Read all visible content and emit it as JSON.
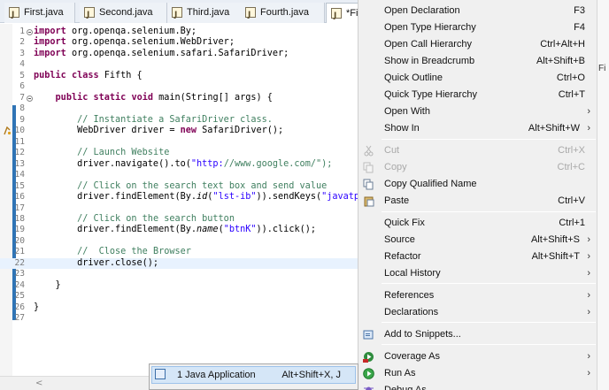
{
  "tabs": [
    {
      "label": "First.java"
    },
    {
      "label": "Second.java"
    },
    {
      "label": "Third.java"
    },
    {
      "label": "Fourth.java"
    },
    {
      "label": "*Fif"
    }
  ],
  "code_lines": [
    {
      "n": "1",
      "text": "import org.openqa.selenium.By;"
    },
    {
      "n": "2",
      "text": "import org.openqa.selenium.WebDriver;"
    },
    {
      "n": "3",
      "text": "import org.openqa.selenium.safari.SafariDriver;"
    },
    {
      "n": "4",
      "text": ""
    },
    {
      "n": "5",
      "text": "public class Fifth {"
    },
    {
      "n": "6",
      "text": ""
    },
    {
      "n": "7",
      "text": "    public static void main(String[] args) {"
    },
    {
      "n": "8",
      "text": ""
    },
    {
      "n": "9",
      "text": "        // Instantiate a SafariDriver class."
    },
    {
      "n": "10",
      "text": "        WebDriver driver = new SafariDriver();"
    },
    {
      "n": "11",
      "text": ""
    },
    {
      "n": "12",
      "text": "        // Launch Website"
    },
    {
      "n": "13",
      "text": "        driver.navigate().to(\"http://www.google.com/\");"
    },
    {
      "n": "14",
      "text": ""
    },
    {
      "n": "15",
      "text": "        // Click on the search text box and send value"
    },
    {
      "n": "16",
      "text": "        driver.findElement(By.id(\"lst-ib\")).sendKeys(\"javatpo"
    },
    {
      "n": "17",
      "text": ""
    },
    {
      "n": "18",
      "text": "        // Click on the search button"
    },
    {
      "n": "19",
      "text": "        driver.findElement(By.name(\"btnK\")).click();"
    },
    {
      "n": "20",
      "text": ""
    },
    {
      "n": "21",
      "text": "        //  Close the Browser"
    },
    {
      "n": "22",
      "text": "        driver.close();"
    },
    {
      "n": "23",
      "text": ""
    },
    {
      "n": "24",
      "text": "    }"
    },
    {
      "n": "25",
      "text": ""
    },
    {
      "n": "26",
      "text": "}"
    },
    {
      "n": "27",
      "text": ""
    }
  ],
  "context_menu": {
    "items": [
      {
        "label": "Open Declaration",
        "shortcut": "F3"
      },
      {
        "label": "Open Type Hierarchy",
        "shortcut": "F4"
      },
      {
        "label": "Open Call Hierarchy",
        "shortcut": "Ctrl+Alt+H"
      },
      {
        "label": "Show in Breadcrumb",
        "shortcut": "Alt+Shift+B"
      },
      {
        "label": "Quick Outline",
        "shortcut": "Ctrl+O"
      },
      {
        "label": "Quick Type Hierarchy",
        "shortcut": "Ctrl+T"
      },
      {
        "label": "Open With",
        "shortcut": "",
        "submenu": true
      },
      {
        "label": "Show In",
        "shortcut": "Alt+Shift+W"
      },
      {
        "label": "Cut",
        "shortcut": "Ctrl+X"
      },
      {
        "label": "Copy",
        "shortcut": "Ctrl+C"
      },
      {
        "label": "Copy Qualified Name",
        "shortcut": ""
      },
      {
        "label": "Paste",
        "shortcut": "Ctrl+V"
      },
      {
        "label": "Quick Fix",
        "shortcut": "Ctrl+1"
      },
      {
        "label": "Source",
        "shortcut": "Alt+Shift+S"
      },
      {
        "label": "Refactor",
        "shortcut": "Alt+Shift+T"
      },
      {
        "label": "Local History",
        "shortcut": ""
      },
      {
        "label": "References",
        "shortcut": ""
      },
      {
        "label": "Declarations",
        "shortcut": ""
      },
      {
        "label": "Add to Snippets...",
        "shortcut": ""
      },
      {
        "label": "Coverage As",
        "shortcut": ""
      },
      {
        "label": "Run As",
        "shortcut": ""
      },
      {
        "label": "Debug As",
        "shortcut": ""
      }
    ],
    "submenu_arrow": "›"
  },
  "run_as_submenu": {
    "label": "1 Java Application",
    "shortcut": "Alt+Shift+X, J"
  },
  "right_strip_text": "Fi",
  "colors": {
    "keyword": "#7f0055",
    "comment": "#3f7f5f",
    "string": "#2a00ff",
    "menu_bg": "#f0f0f0",
    "submenu_highlight": "#d5e6f7",
    "occurrence_bar": "#2f74b5"
  },
  "icons": {
    "tab": "java-file-icon",
    "cut": "scissors-icon",
    "copy": "copy-icon",
    "paste": "paste-icon",
    "snippets": "snippets-icon",
    "coverage": "coverage-icon",
    "run": "run-icon",
    "java_app": "java-app-icon"
  }
}
